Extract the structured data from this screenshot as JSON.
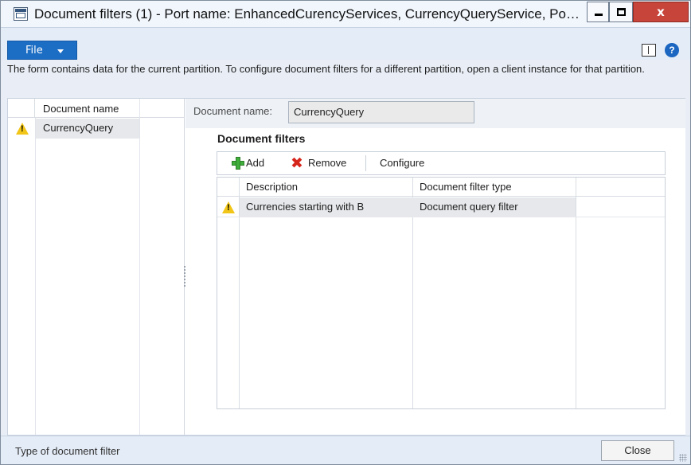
{
  "window": {
    "title": "Document filters (1) - Port name: EnhancedCurencyServices, CurrencyQueryService, Po…",
    "minimize_glyph": "",
    "close_glyph": "x"
  },
  "menu": {
    "file_label": "File"
  },
  "info": {
    "message": "The form contains data for the current partition. To configure document filters for a different partition, open a client instance for that partition."
  },
  "left_grid": {
    "header": "Document name",
    "rows": [
      {
        "name": "CurrencyQuery",
        "status_icon": "warning-icon"
      }
    ]
  },
  "detail": {
    "document_name_label": "Document name:",
    "document_name_value": "CurrencyQuery",
    "section_title": "Document filters",
    "toolbar": {
      "add_label": "Add",
      "remove_label": "Remove",
      "configure_label": "Configure"
    },
    "grid": {
      "columns": [
        "Description",
        "Document filter type"
      ],
      "rows": [
        {
          "description": "Currencies starting with B",
          "type": "Document query filter",
          "status_icon": "warning-icon"
        }
      ]
    }
  },
  "status": {
    "text": "Type of document filter",
    "close_label": "Close"
  },
  "colors": {
    "file_button": "#1c6dc4",
    "close_window": "#c7443a",
    "warning": "#f2c618",
    "add_icon": "#3fae3a",
    "remove_icon": "#d6251b"
  }
}
